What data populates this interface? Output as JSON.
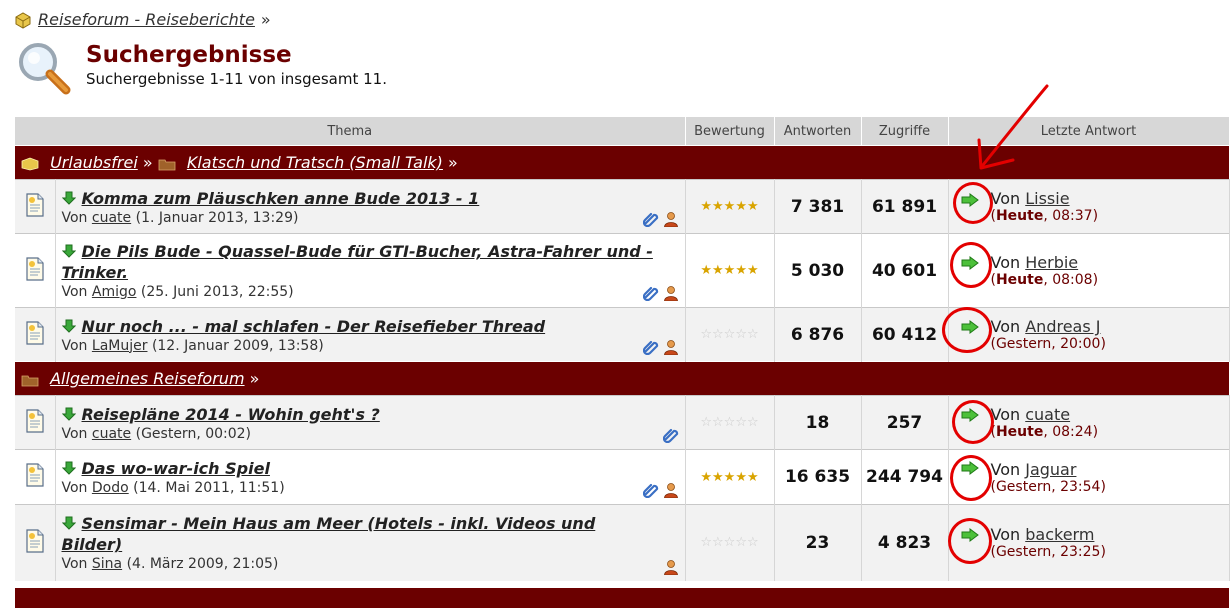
{
  "breadcrumb": {
    "label": "Reiseforum - Reiseberichte",
    "sep": "»"
  },
  "header": {
    "title": "Suchergebnisse",
    "subtitle": "Suchergebnisse 1-11 von insgesamt 11."
  },
  "columns": {
    "thema": "Thema",
    "bewertung": "Bewertung",
    "antworten": "Antworten",
    "zugriffe": "Zugriffe",
    "letzte": "Letzte Antwort"
  },
  "sections": [
    {
      "parts": [
        "Urlaubsfrei",
        "Klatsch und Tratsch (Small Talk)"
      ],
      "sep": "»"
    },
    {
      "parts": [
        "Allgemeines Reiseforum"
      ],
      "sep": "»"
    }
  ],
  "threads": [
    {
      "title": "Komma zum Pläuschken anne Bude 2013 - 1",
      "by_prefix": "Von",
      "author": "cuate",
      "date": "(1. Januar 2013, 13:29)",
      "stars": 5,
      "replies": "7 381",
      "views": "61 891",
      "last_prefix": "Von",
      "last_user": "Lissie",
      "last_day": "Heute",
      "last_time": ", 08:37)"
    },
    {
      "title": "Die Pils Bude - Quassel-Bude für GTI-Bucher, Astra-Fahrer und -Trinker.",
      "by_prefix": "Von",
      "author": "Amigo",
      "date": "(25. Juni 2013, 22:55)",
      "stars": 5,
      "replies": "5 030",
      "views": "40 601",
      "last_prefix": "Von",
      "last_user": "Herbie",
      "last_day": "Heute",
      "last_time": ", 08:08)"
    },
    {
      "title": "Nur noch ... - mal schlafen - Der Reisefieber Thread",
      "by_prefix": "Von",
      "author": "LaMujer",
      "date": "(12. Januar 2009, 13:58)",
      "stars": 0,
      "replies": "6 876",
      "views": "60 412",
      "last_prefix": "Von",
      "last_user": "Andreas J",
      "last_plain": "(Gestern, 20:00)"
    },
    {
      "title": "Reisepläne 2014 - Wohin geht's ?",
      "by_prefix": "Von",
      "author": "cuate",
      "date": "(Gestern, 00:02)",
      "stars": 0,
      "replies": "18",
      "views": "257",
      "last_prefix": "Von",
      "last_user": "cuate",
      "last_day": "Heute",
      "last_time": ", 08:24)"
    },
    {
      "title": "Das wo-war-ich Spiel",
      "by_prefix": "Von",
      "author": "Dodo",
      "date": "(14. Mai 2011, 11:51)",
      "stars": 5,
      "replies": "16 635",
      "views": "244 794",
      "last_prefix": "Von",
      "last_user": "Jaguar",
      "last_plain": "(Gestern, 23:54)"
    },
    {
      "title": "Sensimar - Mein Haus am Meer (Hotels - inkl. Videos und Bilder)",
      "by_prefix": "Von",
      "author": "Sina",
      "date": "(4. März 2009, 21:05)",
      "stars": 0,
      "replies": "23",
      "views": "4 823",
      "last_prefix": "Von",
      "last_user": "backerm",
      "last_plain": "(Gestern, 23:25)"
    }
  ],
  "colors": {
    "accent": "#6b0000",
    "annotation": "#e30000"
  }
}
